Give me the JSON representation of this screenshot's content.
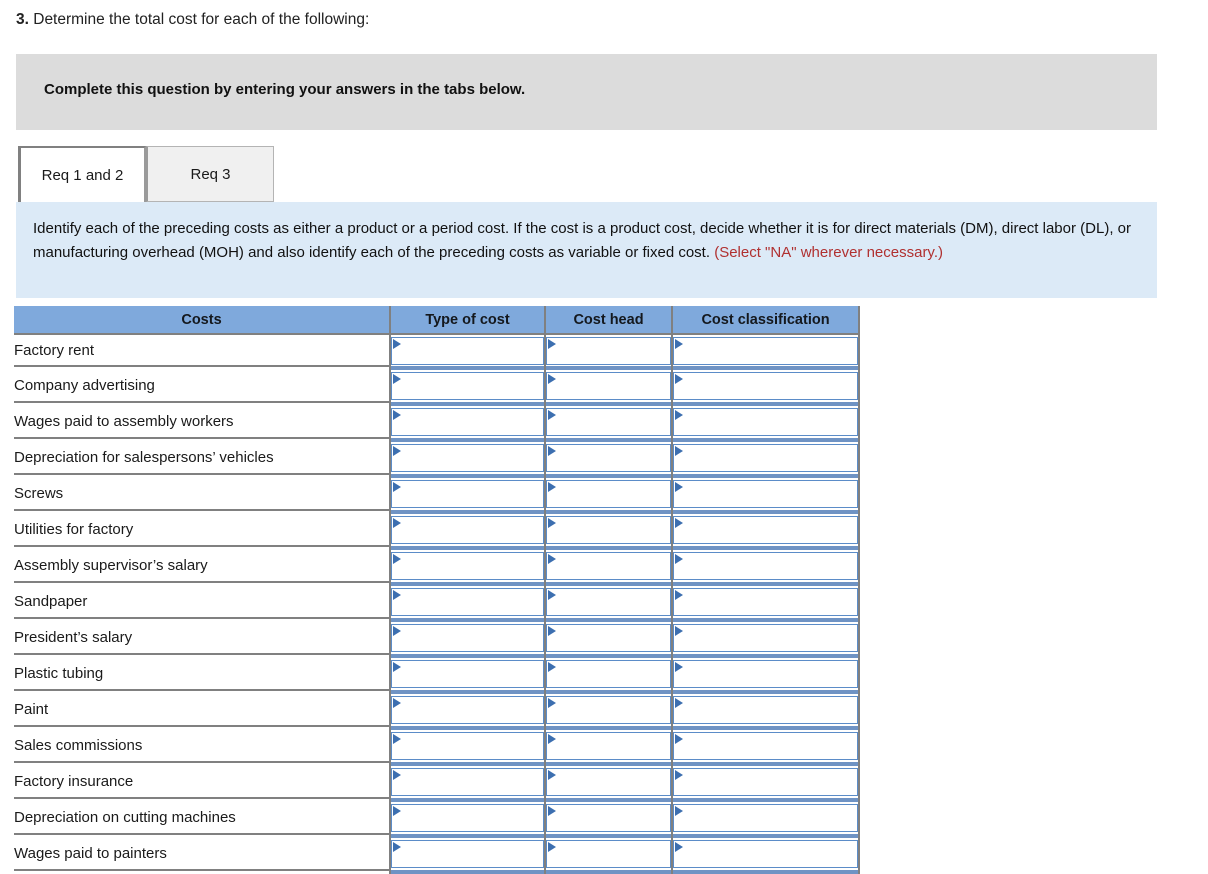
{
  "question": {
    "number": "3.",
    "text": " Determine the total cost for each of the following:"
  },
  "banner": {
    "text": "Complete this question by entering your answers in the tabs below."
  },
  "tabs": [
    {
      "label": "Req 1 and 2",
      "state": "active"
    },
    {
      "label": "Req 3",
      "state": "inactive"
    }
  ],
  "instructions": {
    "main": "Identify each of the preceding costs as either a product or a period cost. If the cost is a product cost, decide whether it is for direct materials (DM), direct labor (DL), or manufacturing overhead (MOH) and also identify each of the preceding costs as variable or fixed cost. ",
    "note": "(Select \"NA\" wherever necessary.)"
  },
  "table": {
    "columns": [
      "Costs",
      "Type of cost",
      "Cost head",
      "Cost classification"
    ],
    "rows": [
      {
        "cost": "Factory rent",
        "type_of_cost": "",
        "cost_head": "",
        "cost_classification": ""
      },
      {
        "cost": "Company advertising",
        "type_of_cost": "",
        "cost_head": "",
        "cost_classification": ""
      },
      {
        "cost": "Wages paid to assembly workers",
        "type_of_cost": "",
        "cost_head": "",
        "cost_classification": ""
      },
      {
        "cost": "Depreciation for salespersons’ vehicles",
        "type_of_cost": "",
        "cost_head": "",
        "cost_classification": ""
      },
      {
        "cost": "Screws",
        "type_of_cost": "",
        "cost_head": "",
        "cost_classification": ""
      },
      {
        "cost": "Utilities for factory",
        "type_of_cost": "",
        "cost_head": "",
        "cost_classification": ""
      },
      {
        "cost": "Assembly supervisor’s salary",
        "type_of_cost": "",
        "cost_head": "",
        "cost_classification": ""
      },
      {
        "cost": "Sandpaper",
        "type_of_cost": "",
        "cost_head": "",
        "cost_classification": ""
      },
      {
        "cost": "President’s salary",
        "type_of_cost": "",
        "cost_head": "",
        "cost_classification": ""
      },
      {
        "cost": "Plastic tubing",
        "type_of_cost": "",
        "cost_head": "",
        "cost_classification": ""
      },
      {
        "cost": "Paint",
        "type_of_cost": "",
        "cost_head": "",
        "cost_classification": ""
      },
      {
        "cost": "Sales commissions",
        "type_of_cost": "",
        "cost_head": "",
        "cost_classification": ""
      },
      {
        "cost": "Factory insurance",
        "type_of_cost": "",
        "cost_head": "",
        "cost_classification": ""
      },
      {
        "cost": "Depreciation on cutting machines",
        "type_of_cost": "",
        "cost_head": "",
        "cost_classification": ""
      },
      {
        "cost": "Wages paid to painters",
        "type_of_cost": "",
        "cost_head": "",
        "cost_classification": ""
      }
    ]
  },
  "colors": {
    "header_blue": "#7fa9dc",
    "panel_blue": "#dceaf7",
    "banner_gray": "#dcdcdc",
    "note_red": "#b03030",
    "dropdown_border": "#5b8cc8",
    "dropdown_flag": "#3d6fb0"
  }
}
